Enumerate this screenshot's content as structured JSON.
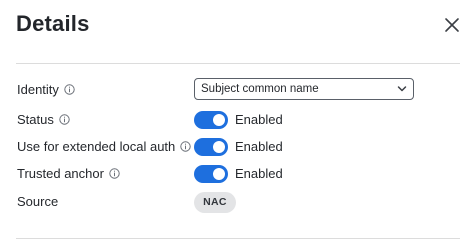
{
  "header": {
    "title": "Details",
    "close_icon": "close-icon"
  },
  "fields": {
    "identity": {
      "label": "Identity",
      "value": "Subject common name"
    },
    "status": {
      "label": "Status",
      "value": "Enabled",
      "enabled": true
    },
    "extended_auth": {
      "label": "Use for extended local auth",
      "value": "Enabled",
      "enabled": true
    },
    "trusted_anchor": {
      "label": "Trusted anchor",
      "value": "Enabled",
      "enabled": true
    },
    "source": {
      "label": "Source",
      "value": "NAC"
    }
  },
  "colors": {
    "toggle_on": "#1e6fde",
    "badge_bg": "#e3e4e6",
    "text": "#25282d"
  }
}
